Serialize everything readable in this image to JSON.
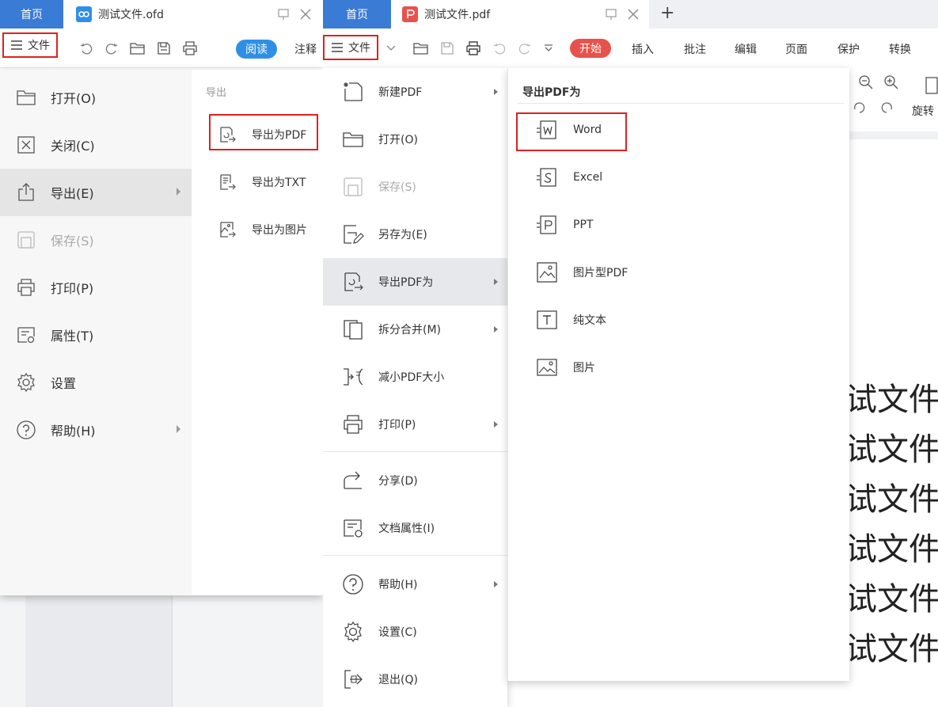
{
  "left_window": {
    "tabs": {
      "home": "首页",
      "doc": "测试文件.ofd"
    },
    "toolbar": {
      "file_label": "文件",
      "read_label": "阅读",
      "annotate_label": "注释"
    },
    "menu": {
      "items": [
        {
          "label": "打开(O)",
          "icon": "folder-open-icon"
        },
        {
          "label": "关闭(C)",
          "icon": "close-box-icon"
        },
        {
          "label": "导出(E)",
          "icon": "export-icon",
          "active": true,
          "has_sub": true
        },
        {
          "label": "保存(S)",
          "icon": "save-icon",
          "disabled": true
        },
        {
          "label": "打印(P)",
          "icon": "print-icon"
        },
        {
          "label": "属性(T)",
          "icon": "properties-icon"
        },
        {
          "label": "设置",
          "icon": "gear-icon"
        },
        {
          "label": "帮助(H)",
          "icon": "help-icon",
          "has_sub": true
        }
      ]
    },
    "submenu": {
      "header": "导出",
      "items": [
        {
          "label": "导出为PDF",
          "icon": "export-pdf-icon",
          "highlighted": true
        },
        {
          "label": "导出为TXT",
          "icon": "export-txt-icon"
        },
        {
          "label": "导出为图片",
          "icon": "export-image-icon"
        }
      ]
    }
  },
  "right_window": {
    "tabs": {
      "home": "首页",
      "doc": "测试文件.pdf",
      "new_tab": "+"
    },
    "toolbar": {
      "file_label": "文件",
      "start_label": "开始",
      "ribbon_tabs": [
        "插入",
        "批注",
        "编辑",
        "页面",
        "保护",
        "转换"
      ]
    },
    "subtoolbar": {
      "rotate_label": "旋转"
    },
    "menu": {
      "items": [
        {
          "label": "新建PDF",
          "icon": "new-pdf-icon",
          "has_sub": true
        },
        {
          "label": "打开(O)",
          "icon": "folder-open-icon"
        },
        {
          "label": "保存(S)",
          "icon": "save-icon",
          "disabled": true
        },
        {
          "label": "另存为(E)",
          "icon": "save-as-icon"
        },
        {
          "label": "导出PDF为",
          "icon": "export-pdf-icon",
          "active": true,
          "has_sub": true
        },
        {
          "label": "拆分合并(M)",
          "icon": "split-merge-icon",
          "has_sub": true
        },
        {
          "label": "减小PDF大小",
          "icon": "compress-icon"
        },
        {
          "label": "打印(P)",
          "icon": "print-icon",
          "has_sub": true
        },
        {
          "label": "分享(D)",
          "icon": "share-icon"
        },
        {
          "label": "文档属性(I)",
          "icon": "doc-properties-icon"
        },
        {
          "label": "帮助(H)",
          "icon": "help-icon",
          "has_sub": true
        },
        {
          "label": "设置(C)",
          "icon": "gear-icon"
        },
        {
          "label": "退出(Q)",
          "icon": "exit-icon"
        }
      ]
    },
    "submenu": {
      "header": "导出PDF为",
      "items": [
        {
          "label": "Word",
          "icon": "word-icon",
          "highlighted": true
        },
        {
          "label": "Excel",
          "icon": "excel-icon"
        },
        {
          "label": "PPT",
          "icon": "ppt-icon"
        },
        {
          "label": "图片型PDF",
          "icon": "image-pdf-icon"
        },
        {
          "label": "纯文本",
          "icon": "plain-text-icon"
        },
        {
          "label": "图片",
          "icon": "picture-icon"
        }
      ]
    },
    "document": {
      "lines": [
        "试文件",
        "试文件",
        "试文件",
        "试文件",
        "试文件",
        "试文件"
      ]
    }
  },
  "colors": {
    "home_tab": "#3a7bd5",
    "highlight_box": "#e02020",
    "read_button": "#2f8fe8",
    "start_button": "#e8524c"
  }
}
